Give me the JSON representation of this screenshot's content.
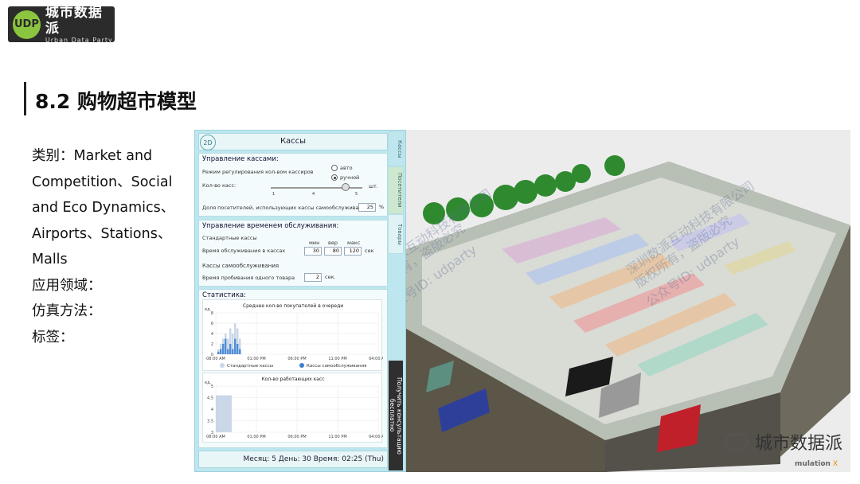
{
  "logo": {
    "mark": "UDP",
    "name": "城市数据派",
    "tagline": "Urban Data Party"
  },
  "slide": {
    "title": "8.2 购物超市模型",
    "meta": {
      "category_lines": [
        "类别：Market and",
        "Competition、Social",
        "and Eco Dynamics、",
        "Airports、Stations、",
        "Malls"
      ],
      "application": "应用领域：",
      "method": "仿真方法：",
      "tags": "标签："
    }
  },
  "panel": {
    "mode_button": "2D",
    "title": "Кассы",
    "tabs": [
      "Кассы",
      "Посетители",
      "Товары"
    ],
    "cta": "Получить консультацию бесплатно",
    "cashiers": {
      "heading": "Управление кассами:",
      "mode_label": "Режим регулирования кол-вом кассиров",
      "mode_options": [
        "авто",
        "ручной"
      ],
      "mode_selected": "ручной",
      "count_label": "Кол-во касс:",
      "slider_ticks": [
        "1",
        "4",
        "5"
      ],
      "slider_value": 0.82,
      "unit_pcs": "шт.",
      "self_share_label": "Доля посетителей, использующих кассы самообслуживания",
      "self_share_value": "25",
      "unit_pct": "%"
    },
    "service": {
      "heading": "Управление временем обслуживания:",
      "standard_label": "Стандартные кассы",
      "cols": [
        "мин",
        "вер",
        "макс"
      ],
      "time_label": "Время обслуживания в кассах",
      "min": "30",
      "mode": "80",
      "max": "120",
      "unit_sec": "сек",
      "self_label": "Кассы самообслуживания",
      "scan_label": "Время пробивания одного товара",
      "scan_value": "2",
      "scan_unit": "сек."
    },
    "stats": {
      "heading": "Статистика:",
      "footer": "Месяц: 5 День: 30 Время: 02:25 (Thu)"
    }
  },
  "chart_data": [
    {
      "type": "bar",
      "title": "Среднее кол-во покупателей в очереди",
      "ylabel": "ед.",
      "ylim": [
        0,
        8
      ],
      "y_ticks": [
        "8",
        "6",
        "4",
        "2",
        "0"
      ],
      "x_ticks": [
        "08:00 AM",
        "01:00 PM",
        "06:00 PM",
        "11:00 PM",
        "04:00 AM"
      ],
      "legend_position": "bottom",
      "series": [
        {
          "name": "Стандартные кассы",
          "color": "#c9d7e8",
          "values": [
            1,
            2,
            3,
            4,
            3,
            5,
            4,
            6,
            5,
            3
          ]
        },
        {
          "name": "Кассы самообслуживания",
          "color": "#3b7fd0",
          "values": [
            0.5,
            1,
            2,
            3,
            1,
            2,
            1,
            3,
            2,
            1
          ]
        }
      ]
    },
    {
      "type": "area",
      "title": "Кол-во работающих касс",
      "ylabel": "ед.",
      "ylim": [
        0,
        5
      ],
      "y_ticks": [
        "5",
        "4.5",
        "4",
        "3.5",
        "3"
      ],
      "x_ticks": [
        "08:00 AM",
        "01:00 PM",
        "06:00 PM",
        "11:00 PM",
        "04:00 AM"
      ],
      "series": [
        {
          "values": [
            4,
            4
          ]
        }
      ]
    }
  ],
  "scene": {
    "watermark": "城市数据派",
    "brand": "mulation",
    "brand_suffix": "X",
    "overlay": [
      "深圳数派互动科技有限公司",
      "版权所有，盗版必究",
      "公众号ID: udparty"
    ]
  }
}
